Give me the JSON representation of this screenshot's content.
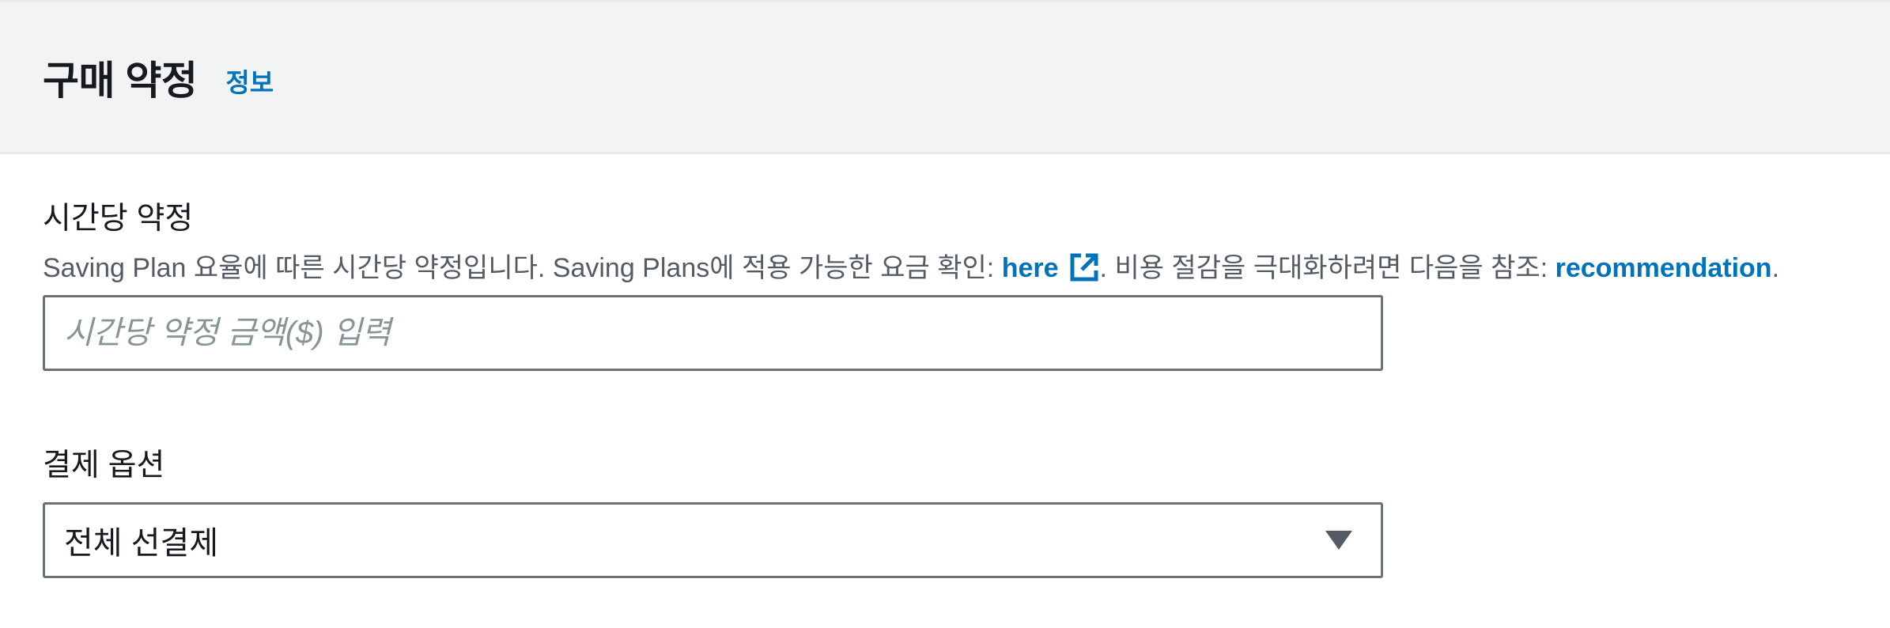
{
  "header": {
    "title": "구매 약정",
    "info_link": "정보"
  },
  "hourly_commitment": {
    "label": "시간당 약정",
    "description_part1": "Saving Plan 요율에 따른 시간당 약정입니다. Saving Plans에 적용 가능한 요금 확인: ",
    "here_link": "here",
    "description_part2": ". 비용 절감을 극대화하려면 다음을 참조: ",
    "recommendation_link": "recommendation",
    "description_part3": ".",
    "input_value": "",
    "input_placeholder": "시간당 약정 금액($) 입력",
    "external_link_icon": "external-link-icon"
  },
  "payment_option": {
    "label": "결제 옵션",
    "selected_value": "전체 선결제",
    "dropdown_icon": "caret-down-icon"
  },
  "colors": {
    "link": "#0073bb",
    "header_bg": "#f2f3f3",
    "input_border": "#687078",
    "placeholder": "#879596"
  }
}
